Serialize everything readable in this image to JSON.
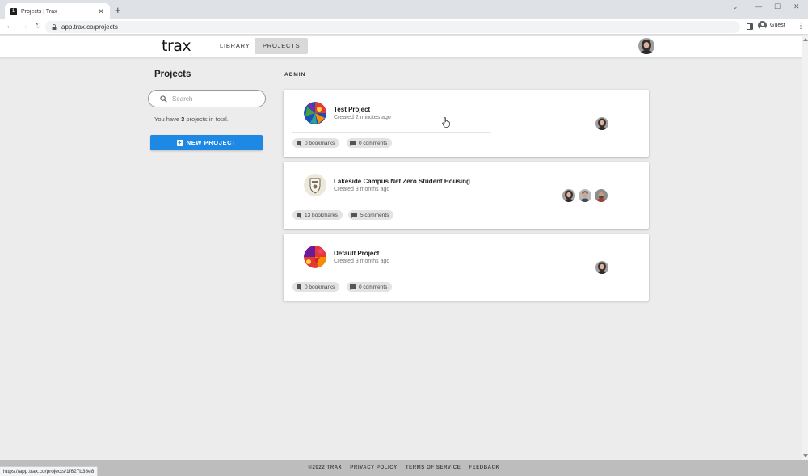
{
  "browser": {
    "tab_title": "Projects | Trax",
    "tab_favicon": "1",
    "url": "app.trax.co/projects",
    "profile_name": "Guest",
    "status_url": "https://app.trax.co/projects/1f627b38e8"
  },
  "header": {
    "logo": "trax",
    "nav": [
      "LIBRARY",
      "PROJECTS"
    ],
    "active_nav": "PROJECTS"
  },
  "sidebar": {
    "title": "Projects",
    "search_placeholder": "Search",
    "count_prefix": "You have ",
    "count": "3",
    "count_suffix": " projects in total.",
    "new_project_label": "NEW PROJECT"
  },
  "main": {
    "section_label": "ADMIN",
    "projects": [
      {
        "name": "Test Project",
        "created": "Created 2 minutes ago",
        "bookmarks": "0 bookmarks",
        "comments": "0 comments",
        "members": 1,
        "thumb": "colorful-globe-icon"
      },
      {
        "name": "Lakeside Campus Net Zero Student Housing",
        "created": "Created 3 months ago",
        "bookmarks": "13 bookmarks",
        "comments": "5 comments",
        "members": 3,
        "thumb": "crest-icon"
      },
      {
        "name": "Default Project",
        "created": "Created 3 months ago",
        "bookmarks": "0 bookmarks",
        "comments": "0 comments",
        "members": 1,
        "thumb": "colorful-mosaic-icon"
      }
    ]
  },
  "footer": {
    "links": [
      "©2022 TRAX",
      "PRIVACY POLICY",
      "TERMS OF SERVICE",
      "FEEDBACK"
    ]
  },
  "colors": {
    "accent": "#1e88e5",
    "background": "#ececec",
    "footer": "#bdbdbd"
  }
}
